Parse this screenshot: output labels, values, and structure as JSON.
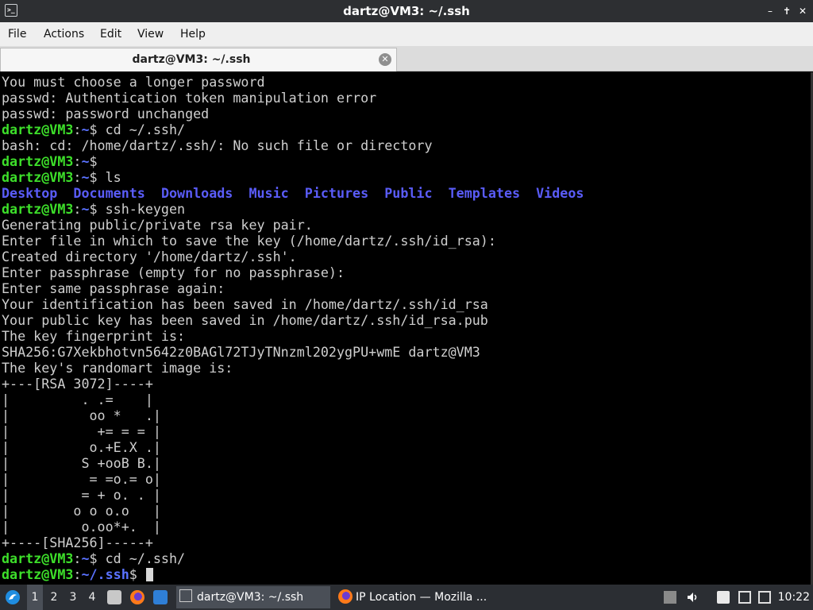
{
  "window": {
    "title": "dartz@VM3: ~/.ssh",
    "controls": [
      "minimize-icon",
      "maximize-icon",
      "close-icon"
    ]
  },
  "menu": {
    "items": [
      "File",
      "Actions",
      "Edit",
      "View",
      "Help"
    ]
  },
  "tab": {
    "label": "dartz@VM3: ~/.ssh"
  },
  "terminal": {
    "lines": [
      [
        {
          "t": "You must choose a longer password",
          "c": ""
        }
      ],
      [
        {
          "t": "passwd: Authentication token manipulation error",
          "c": ""
        }
      ],
      [
        {
          "t": "passwd: password unchanged",
          "c": ""
        }
      ],
      [
        {
          "t": "dartz@VM3",
          "c": "u"
        },
        {
          "t": ":",
          "c": ""
        },
        {
          "t": "~",
          "c": "p"
        },
        {
          "t": "$ cd ~/.ssh/",
          "c": ""
        }
      ],
      [
        {
          "t": "bash: cd: /home/dartz/.ssh/: No such file or directory",
          "c": ""
        }
      ],
      [
        {
          "t": "dartz@VM3",
          "c": "u"
        },
        {
          "t": ":",
          "c": ""
        },
        {
          "t": "~",
          "c": "p"
        },
        {
          "t": "$",
          "c": ""
        }
      ],
      [
        {
          "t": "dartz@VM3",
          "c": "u"
        },
        {
          "t": ":",
          "c": ""
        },
        {
          "t": "~",
          "c": "p"
        },
        {
          "t": "$ ls",
          "c": ""
        }
      ],
      [
        {
          "t": "Desktop",
          "c": "d"
        },
        {
          "t": "  ",
          "c": ""
        },
        {
          "t": "Documents",
          "c": "d"
        },
        {
          "t": "  ",
          "c": ""
        },
        {
          "t": "Downloads",
          "c": "d"
        },
        {
          "t": "  ",
          "c": ""
        },
        {
          "t": "Music",
          "c": "d"
        },
        {
          "t": "  ",
          "c": ""
        },
        {
          "t": "Pictures",
          "c": "d"
        },
        {
          "t": "  ",
          "c": ""
        },
        {
          "t": "Public",
          "c": "d"
        },
        {
          "t": "  ",
          "c": ""
        },
        {
          "t": "Templates",
          "c": "d"
        },
        {
          "t": "  ",
          "c": ""
        },
        {
          "t": "Videos",
          "c": "d"
        }
      ],
      [
        {
          "t": "dartz@VM3",
          "c": "u"
        },
        {
          "t": ":",
          "c": ""
        },
        {
          "t": "~",
          "c": "p"
        },
        {
          "t": "$ ssh-keygen",
          "c": ""
        }
      ],
      [
        {
          "t": "Generating public/private rsa key pair.",
          "c": ""
        }
      ],
      [
        {
          "t": "Enter file in which to save the key (/home/dartz/.ssh/id_rsa):",
          "c": ""
        }
      ],
      [
        {
          "t": "Created directory '/home/dartz/.ssh'.",
          "c": ""
        }
      ],
      [
        {
          "t": "Enter passphrase (empty for no passphrase):",
          "c": ""
        }
      ],
      [
        {
          "t": "Enter same passphrase again:",
          "c": ""
        }
      ],
      [
        {
          "t": "Your identification has been saved in /home/dartz/.ssh/id_rsa",
          "c": ""
        }
      ],
      [
        {
          "t": "Your public key has been saved in /home/dartz/.ssh/id_rsa.pub",
          "c": ""
        }
      ],
      [
        {
          "t": "The key fingerprint is:",
          "c": ""
        }
      ],
      [
        {
          "t": "SHA256:G7Xekbhotvn5642z0BAGl72TJyTNnzml202ygPU+wmE dartz@VM3",
          "c": ""
        }
      ],
      [
        {
          "t": "The key's randomart image is:",
          "c": ""
        }
      ],
      [
        {
          "t": "+---[RSA 3072]----+",
          "c": ""
        }
      ],
      [
        {
          "t": "|         . .=    |",
          "c": ""
        }
      ],
      [
        {
          "t": "|          oo *   .|",
          "c": ""
        }
      ],
      [
        {
          "t": "|           += = = |",
          "c": ""
        }
      ],
      [
        {
          "t": "|          o.+E.X .|",
          "c": ""
        }
      ],
      [
        {
          "t": "|         S +ooB B.|",
          "c": ""
        }
      ],
      [
        {
          "t": "|          = =o.= o|",
          "c": ""
        }
      ],
      [
        {
          "t": "|         = + o. . |",
          "c": ""
        }
      ],
      [
        {
          "t": "|        o o o.o   |",
          "c": ""
        }
      ],
      [
        {
          "t": "|         o.oo*+.  |",
          "c": ""
        }
      ],
      [
        {
          "t": "+----[SHA256]-----+",
          "c": ""
        }
      ],
      [
        {
          "t": "dartz@VM3",
          "c": "u"
        },
        {
          "t": ":",
          "c": ""
        },
        {
          "t": "~",
          "c": "p"
        },
        {
          "t": "$ cd ~/.ssh/",
          "c": ""
        }
      ],
      [
        {
          "t": "dartz@VM3",
          "c": "u"
        },
        {
          "t": ":",
          "c": ""
        },
        {
          "t": "~/.ssh",
          "c": "p"
        },
        {
          "t": "$ ",
          "c": ""
        }
      ]
    ]
  },
  "taskbar": {
    "workspaces": [
      "1",
      "2",
      "3",
      "4"
    ],
    "active_workspace": "1",
    "tasks": [
      {
        "label": "dartz@VM3: ~/.ssh",
        "icon": "terminal-icon"
      },
      {
        "label": "IP Location — Mozilla ...",
        "icon": "firefox-icon"
      }
    ],
    "clock": "10:22"
  },
  "colors": {
    "user_prompt": "#3ddf2a",
    "path": "#5a72ff",
    "directory": "#5a5cf8",
    "terminal_bg": "#000000",
    "terminal_fg": "#cfcfcf",
    "titlebar_bg": "#2d2f32",
    "taskbar_bg": "#2b2e33"
  }
}
